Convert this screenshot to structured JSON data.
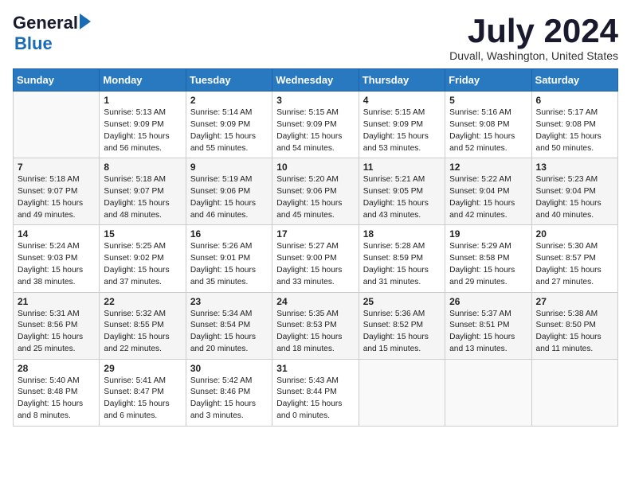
{
  "header": {
    "logo_general": "General",
    "logo_blue": "Blue",
    "month_title": "July 2024",
    "location": "Duvall, Washington, United States"
  },
  "weekdays": [
    "Sunday",
    "Monday",
    "Tuesday",
    "Wednesday",
    "Thursday",
    "Friday",
    "Saturday"
  ],
  "weeks": [
    [
      {
        "day": "",
        "info": ""
      },
      {
        "day": "1",
        "info": "Sunrise: 5:13 AM\nSunset: 9:09 PM\nDaylight: 15 hours\nand 56 minutes."
      },
      {
        "day": "2",
        "info": "Sunrise: 5:14 AM\nSunset: 9:09 PM\nDaylight: 15 hours\nand 55 minutes."
      },
      {
        "day": "3",
        "info": "Sunrise: 5:15 AM\nSunset: 9:09 PM\nDaylight: 15 hours\nand 54 minutes."
      },
      {
        "day": "4",
        "info": "Sunrise: 5:15 AM\nSunset: 9:09 PM\nDaylight: 15 hours\nand 53 minutes."
      },
      {
        "day": "5",
        "info": "Sunrise: 5:16 AM\nSunset: 9:08 PM\nDaylight: 15 hours\nand 52 minutes."
      },
      {
        "day": "6",
        "info": "Sunrise: 5:17 AM\nSunset: 9:08 PM\nDaylight: 15 hours\nand 50 minutes."
      }
    ],
    [
      {
        "day": "7",
        "info": "Sunrise: 5:18 AM\nSunset: 9:07 PM\nDaylight: 15 hours\nand 49 minutes."
      },
      {
        "day": "8",
        "info": "Sunrise: 5:18 AM\nSunset: 9:07 PM\nDaylight: 15 hours\nand 48 minutes."
      },
      {
        "day": "9",
        "info": "Sunrise: 5:19 AM\nSunset: 9:06 PM\nDaylight: 15 hours\nand 46 minutes."
      },
      {
        "day": "10",
        "info": "Sunrise: 5:20 AM\nSunset: 9:06 PM\nDaylight: 15 hours\nand 45 minutes."
      },
      {
        "day": "11",
        "info": "Sunrise: 5:21 AM\nSunset: 9:05 PM\nDaylight: 15 hours\nand 43 minutes."
      },
      {
        "day": "12",
        "info": "Sunrise: 5:22 AM\nSunset: 9:04 PM\nDaylight: 15 hours\nand 42 minutes."
      },
      {
        "day": "13",
        "info": "Sunrise: 5:23 AM\nSunset: 9:04 PM\nDaylight: 15 hours\nand 40 minutes."
      }
    ],
    [
      {
        "day": "14",
        "info": "Sunrise: 5:24 AM\nSunset: 9:03 PM\nDaylight: 15 hours\nand 38 minutes."
      },
      {
        "day": "15",
        "info": "Sunrise: 5:25 AM\nSunset: 9:02 PM\nDaylight: 15 hours\nand 37 minutes."
      },
      {
        "day": "16",
        "info": "Sunrise: 5:26 AM\nSunset: 9:01 PM\nDaylight: 15 hours\nand 35 minutes."
      },
      {
        "day": "17",
        "info": "Sunrise: 5:27 AM\nSunset: 9:00 PM\nDaylight: 15 hours\nand 33 minutes."
      },
      {
        "day": "18",
        "info": "Sunrise: 5:28 AM\nSunset: 8:59 PM\nDaylight: 15 hours\nand 31 minutes."
      },
      {
        "day": "19",
        "info": "Sunrise: 5:29 AM\nSunset: 8:58 PM\nDaylight: 15 hours\nand 29 minutes."
      },
      {
        "day": "20",
        "info": "Sunrise: 5:30 AM\nSunset: 8:57 PM\nDaylight: 15 hours\nand 27 minutes."
      }
    ],
    [
      {
        "day": "21",
        "info": "Sunrise: 5:31 AM\nSunset: 8:56 PM\nDaylight: 15 hours\nand 25 minutes."
      },
      {
        "day": "22",
        "info": "Sunrise: 5:32 AM\nSunset: 8:55 PM\nDaylight: 15 hours\nand 22 minutes."
      },
      {
        "day": "23",
        "info": "Sunrise: 5:34 AM\nSunset: 8:54 PM\nDaylight: 15 hours\nand 20 minutes."
      },
      {
        "day": "24",
        "info": "Sunrise: 5:35 AM\nSunset: 8:53 PM\nDaylight: 15 hours\nand 18 minutes."
      },
      {
        "day": "25",
        "info": "Sunrise: 5:36 AM\nSunset: 8:52 PM\nDaylight: 15 hours\nand 15 minutes."
      },
      {
        "day": "26",
        "info": "Sunrise: 5:37 AM\nSunset: 8:51 PM\nDaylight: 15 hours\nand 13 minutes."
      },
      {
        "day": "27",
        "info": "Sunrise: 5:38 AM\nSunset: 8:50 PM\nDaylight: 15 hours\nand 11 minutes."
      }
    ],
    [
      {
        "day": "28",
        "info": "Sunrise: 5:40 AM\nSunset: 8:48 PM\nDaylight: 15 hours\nand 8 minutes."
      },
      {
        "day": "29",
        "info": "Sunrise: 5:41 AM\nSunset: 8:47 PM\nDaylight: 15 hours\nand 6 minutes."
      },
      {
        "day": "30",
        "info": "Sunrise: 5:42 AM\nSunset: 8:46 PM\nDaylight: 15 hours\nand 3 minutes."
      },
      {
        "day": "31",
        "info": "Sunrise: 5:43 AM\nSunset: 8:44 PM\nDaylight: 15 hours\nand 0 minutes."
      },
      {
        "day": "",
        "info": ""
      },
      {
        "day": "",
        "info": ""
      },
      {
        "day": "",
        "info": ""
      }
    ]
  ]
}
